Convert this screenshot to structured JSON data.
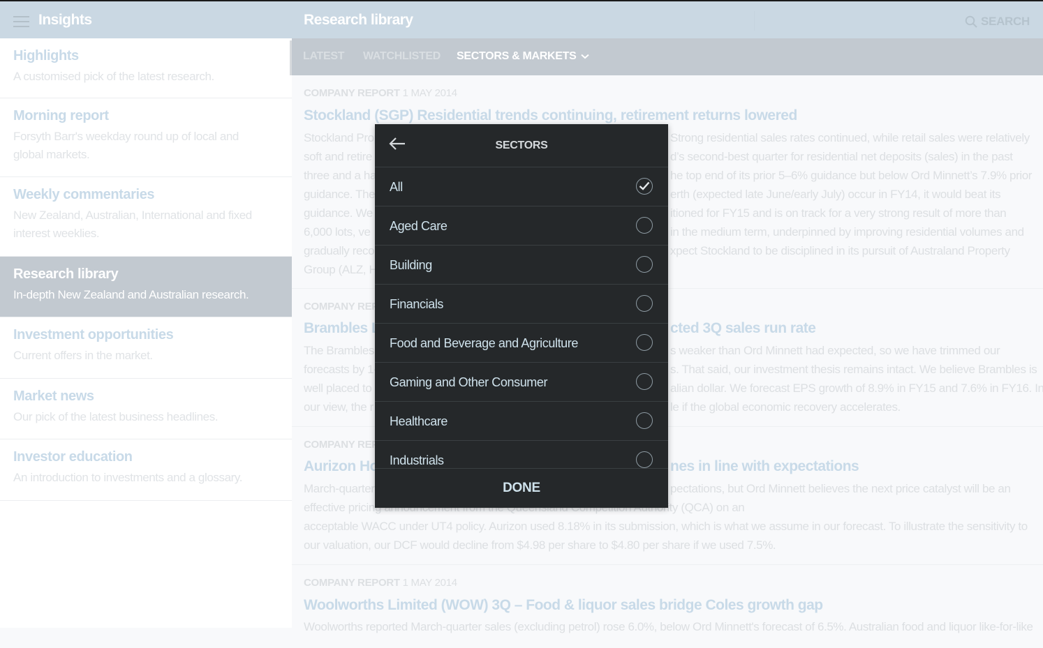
{
  "sidebar": {
    "title": "Insights",
    "menu_icon": "hamburger-menu-icon",
    "items": [
      {
        "title": "Highlights",
        "desc": "A customised pick of the latest research.",
        "active": false
      },
      {
        "title": "Morning report",
        "desc": "Forsyth Barr's weekday round up of local and global markets.",
        "active": false
      },
      {
        "title": "Weekly commentaries",
        "desc": "New Zealand, Australian, International and fixed interest weeklies.",
        "active": false
      },
      {
        "title": "Research library",
        "desc": "In-depth New Zealand and Australian research.",
        "active": true
      },
      {
        "title": "Investment opportunities",
        "desc": "Current offers in the market.",
        "active": false
      },
      {
        "title": "Market news",
        "desc": "Our pick of the latest business headlines.",
        "active": false
      },
      {
        "title": "Investor education",
        "desc": "An introduction to investments and a glossary.",
        "active": false
      }
    ]
  },
  "header": {
    "title": "Research library",
    "search_label": "SEARCH",
    "search_icon": "search-icon"
  },
  "tabs": [
    {
      "label": "LATEST",
      "active": false
    },
    {
      "label": "WATCHLISTED",
      "active": false
    },
    {
      "label": "SECTORS & MARKETS",
      "active": true,
      "icon": "chevron-down-icon"
    }
  ],
  "articles": [
    {
      "kind": "COMPANY REPORT",
      "date": "1 MAY 2014",
      "title": "Stockland (SGP) Residential trends continuing, retirement returns lowered",
      "lines": [
        {
          "left": "Stockland Prop",
          "right": "Strong residential sales rates continued, while retail sales were relatively"
        },
        {
          "left": "soft and retire",
          "right": "d’s second-best quarter for residential net deposits (sales) in the past"
        },
        {
          "left": "three and a ha",
          "right": "he top end of its prior 5–6% guidance but below Ord Minnett’s 7.9% prior"
        },
        {
          "left": "guidance. The",
          "right": "erth (expected late June/early July) occur in FY14, it would beat its"
        },
        {
          "left": "guidance. We",
          "right": "itioned for FY15 and is on track for a very strong result of more than"
        },
        {
          "left": "6,000 lots, ve",
          "right": "in the medium term, underpinned by improving residential volumes and"
        },
        {
          "left": "gradually reco",
          "right": "xpect Stockland to be disciplined in its pursuit of Australand Property"
        },
        {
          "left": "Group (ALZ, Ho",
          "right": ""
        }
      ]
    },
    {
      "kind": "COMPANY REPO",
      "date": "",
      "title": "Brambles Li",
      "title_right": "cted 3Q sales run rate",
      "lines": [
        {
          "left": "The Brambles",
          "right": "s weaker than Ord Minnett had expected, so we have trimmed our"
        },
        {
          "left": "forecasts by 1-",
          "right": "s. That said, our investment thesis remains intact. We believe Brambles is"
        },
        {
          "left": "well placed to",
          "right": "alian dollar. We forecast EPS growth of 8.9% in FY15 and 7.6% in FY16. In"
        },
        {
          "left": "our view, the r",
          "right": "le if the global economic recovery accelerates."
        }
      ]
    },
    {
      "kind": "COMPANY REPO",
      "date": "",
      "title": "Aurizon Hol",
      "title_right": "nes in line with expectations",
      "lines": [
        {
          "left": "March-quarter",
          "right": "pectations, but Ord Minnett believes the next price catalyst will be an"
        },
        {
          "left": "effective pricing announcement from the Queensland Competition Authority (QCA) on an",
          "right": ""
        },
        {
          "left": "acceptable WACC under UT4 policy. Aurizon used 8.18% in its submission, which is what we assume in our forecast. To illustrate the sensitivity to",
          "right": ""
        },
        {
          "left": "our valuation, our DCF would decline from $4.98 per share to $4.80 per share if we used 7.5%.",
          "right": ""
        }
      ]
    },
    {
      "kind": "COMPANY REPORT",
      "date": "1 MAY 2014",
      "title": "Woolworths Limited (WOW) 3Q – Food & liquor sales bridge Coles growth gap",
      "lines": [
        {
          "left": "Woolworths reported March-quarter sales (excluding petrol) rose 6.0%, below Ord Minnett's forecast of 6.5%. Australian food and liquor like-for-like",
          "right": ""
        }
      ]
    }
  ],
  "modal": {
    "title": "SECTORS",
    "back_icon": "arrow-left-icon",
    "options": [
      {
        "label": "All",
        "selected": true
      },
      {
        "label": "Aged Care",
        "selected": false
      },
      {
        "label": "Building",
        "selected": false
      },
      {
        "label": "Financials",
        "selected": false
      },
      {
        "label": "Food and Beverage and Agriculture",
        "selected": false
      },
      {
        "label": "Gaming and Other Consumer",
        "selected": false
      },
      {
        "label": "Healthcare",
        "selected": false
      },
      {
        "label": "Industrials",
        "selected": false
      }
    ],
    "done_label": "DONE"
  },
  "colors": {
    "header_bg": "#cad8e3",
    "tabs_bg": "#c2c9d0",
    "modal_bg": "#25282a",
    "accent_text": "#cfe2ec"
  }
}
